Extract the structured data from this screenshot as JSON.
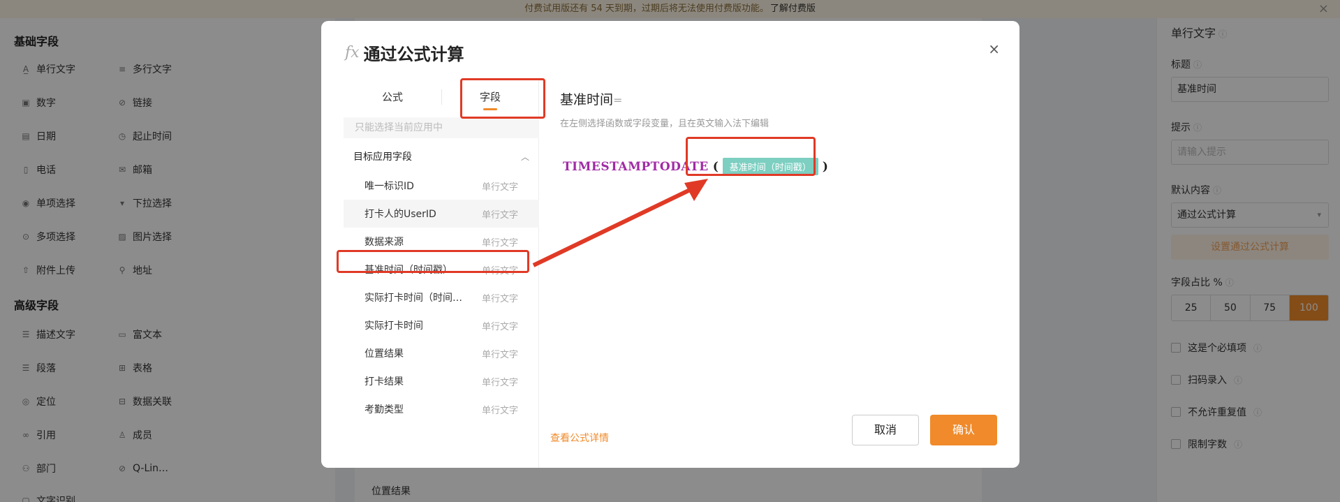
{
  "notice": {
    "text": "付费试用版还有 54 天到期，过期后将无法使用付费版功能。",
    "link": "了解付费版"
  },
  "left_panel": {
    "basic_title": "基础字段",
    "basic_items": [
      {
        "label": "单行文字",
        "icon": "single-line-text-icon"
      },
      {
        "label": "多行文字",
        "icon": "multi-line-text-icon"
      },
      {
        "label": "数字",
        "icon": "number-icon"
      },
      {
        "label": "链接",
        "icon": "link-icon"
      },
      {
        "label": "日期",
        "icon": "date-icon"
      },
      {
        "label": "起止时间",
        "icon": "date-range-icon"
      },
      {
        "label": "电话",
        "icon": "phone-icon"
      },
      {
        "label": "邮箱",
        "icon": "email-icon"
      },
      {
        "label": "单项选择",
        "icon": "radio-icon"
      },
      {
        "label": "下拉选择",
        "icon": "dropdown-icon"
      },
      {
        "label": "多项选择",
        "icon": "checkbox-icon"
      },
      {
        "label": "图片选择",
        "icon": "image-select-icon"
      },
      {
        "label": "附件上传",
        "icon": "upload-icon"
      },
      {
        "label": "地址",
        "icon": "address-icon"
      }
    ],
    "advanced_title": "高级字段",
    "advanced_items": [
      {
        "label": "描述文字",
        "icon": "description-icon"
      },
      {
        "label": "富文本",
        "icon": "rich-text-icon"
      },
      {
        "label": "段落",
        "icon": "paragraph-icon"
      },
      {
        "label": "表格",
        "icon": "table-icon"
      },
      {
        "label": "定位",
        "icon": "location-icon"
      },
      {
        "label": "数据关联",
        "icon": "data-relation-icon"
      },
      {
        "label": "引用",
        "icon": "reference-icon"
      },
      {
        "label": "成员",
        "icon": "member-icon"
      },
      {
        "label": "部门",
        "icon": "department-icon"
      },
      {
        "label": "Q-Lin…",
        "icon": "qlink-icon"
      },
      {
        "label": "文字识别",
        "icon": "ocr-icon"
      }
    ]
  },
  "center": {
    "bottom_label": "位置结果"
  },
  "right_panel": {
    "header": "单行文字",
    "title_label": "标题",
    "title_value": "基准时间",
    "hint_label": "提示",
    "hint_placeholder": "请输入提示",
    "default_label": "默认内容",
    "default_value": "通过公式计算",
    "formula_button": "设置通过公式计算",
    "ratio_label": "字段占比 %",
    "ratio_options": [
      "25",
      "50",
      "75",
      "100"
    ],
    "ratio_selected": "100",
    "checks": [
      "这是个必填项",
      "扫码录入",
      "不允许重复值",
      "限制字数"
    ]
  },
  "modal": {
    "title": "通过公式计算",
    "fx_icon": "fx-icon",
    "close": "×",
    "tabs": [
      "公式",
      "字段"
    ],
    "active_tab": "字段",
    "search_placeholder": "只能选择当前应用中",
    "group": "目标应用字段",
    "fields": [
      {
        "name": "唯一标识ID",
        "type": "单行文字"
      },
      {
        "name": "打卡人的UserID",
        "type": "单行文字"
      },
      {
        "name": "数据来源",
        "type": "单行文字"
      },
      {
        "name": "基准时间（时间戳）",
        "type": "单行文字"
      },
      {
        "name": "实际打卡时间（时间…",
        "type": "单行文字"
      },
      {
        "name": "实际打卡时间",
        "type": "单行文字"
      },
      {
        "name": "位置结果",
        "type": "单行文字"
      },
      {
        "name": "打卡结果",
        "type": "单行文字"
      },
      {
        "name": "考勤类型",
        "type": "单行文字"
      }
    ],
    "formula_field_title": "基准时间",
    "formula_eq": "=",
    "formula_hint": "在左侧选择函数或字段变量，且在英文输入法下编辑",
    "formula_fn": "TIMESTAMPTODATE",
    "formula_open": "(",
    "formula_arg": "基准时间（时间戳）",
    "formula_close": ")",
    "detail_link": "查看公式详情",
    "cancel": "取消",
    "confirm": "确认"
  },
  "colors": {
    "accent": "#f08a2a",
    "annotation": "#e03a26",
    "function": "#a02ba5",
    "chip": "#7ccfc1"
  }
}
